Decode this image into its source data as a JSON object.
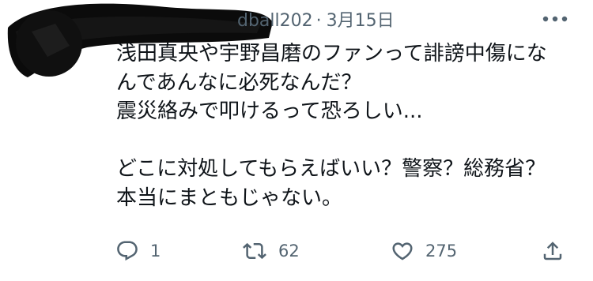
{
  "header": {
    "handle_visible": "dball202",
    "separator": "·",
    "date": "3月15日",
    "more_icon": "more-horizontal-icon"
  },
  "body": {
    "lines": [
      "浅田真央や宇野昌磨のファンって誹謗中傷にな",
      "んであんなに必死なんだ？",
      "震災絡みで叩けるって恐ろしい...",
      "",
      "どこに対処してもらえばいい？警察？総務省？",
      "本当にまともじゃない。"
    ]
  },
  "actions": {
    "reply": {
      "icon": "reply-icon",
      "count": "1"
    },
    "retweet": {
      "icon": "retweet-icon",
      "count": "62"
    },
    "like": {
      "icon": "heart-icon",
      "count": "275"
    },
    "share": {
      "icon": "share-icon"
    }
  },
  "colors": {
    "text": "#0f1419",
    "secondary": "#536471",
    "background": "#ffffff"
  }
}
